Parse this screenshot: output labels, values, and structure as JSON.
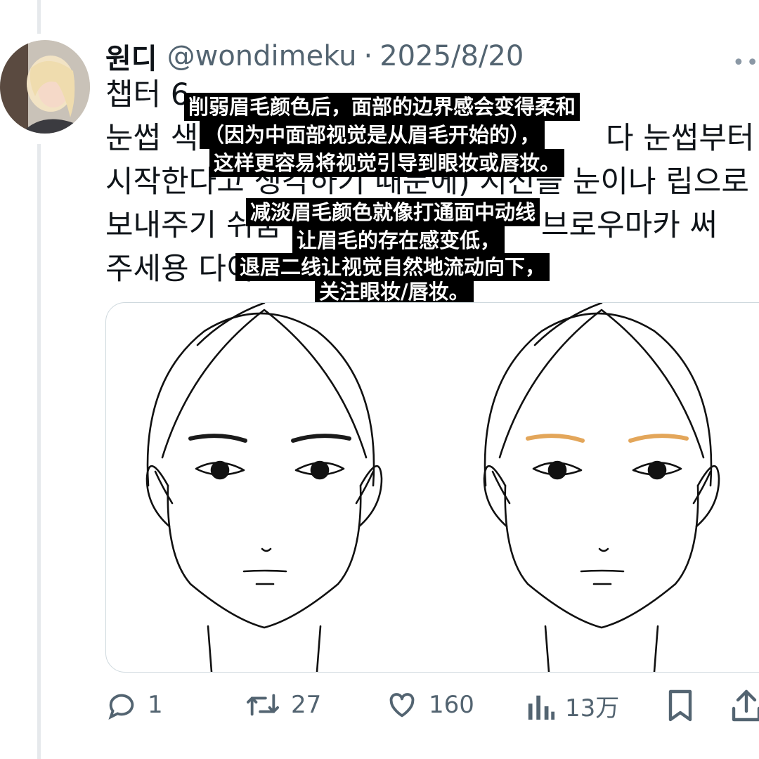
{
  "tweet": {
    "author_name": "원디",
    "handle": "@wondimeku",
    "separator": "·",
    "date": "2025/8/20",
    "text_lines": [
      "챕터 6",
      "눈썹 색",
      "시작한다고 생각하기 때문에) 시선을 눈이나 립으로",
      "보내주기 쉬움",
      "주세용 다이"
    ],
    "text_fragments": {
      "line2_right": "다 눈썹부터",
      "line4_right": "브로우마카 써"
    }
  },
  "overlays": [
    "削弱眉毛颜色后，面部的边界感会变得柔和",
    "（因为中面部视觉是从眉毛开始的），",
    "这样更容易将视觉引导到眼妆或唇妆。",
    "减淡眉毛颜色就像打通面中动线",
    "让眉毛的存在感变低，",
    "退居二线让视觉自然地流动向下，",
    "关注眼妆/唇妆。"
  ],
  "media": {
    "left_brow_color": "#1a1a1a",
    "right_brow_color": "#e3a65a"
  },
  "actions": {
    "reply": {
      "icon": "reply-icon",
      "count": "1"
    },
    "retweet": {
      "icon": "retweet-icon",
      "count": "27"
    },
    "like": {
      "icon": "heart-icon",
      "count": "160"
    },
    "views": {
      "icon": "views-icon",
      "count": "13万"
    },
    "bookmark": {
      "icon": "bookmark-icon"
    },
    "share": {
      "icon": "share-icon"
    }
  },
  "colors": {
    "text": "#0f1419",
    "secondary": "#536471",
    "border": "#cfd9de",
    "overlay_bg": "#000000"
  }
}
